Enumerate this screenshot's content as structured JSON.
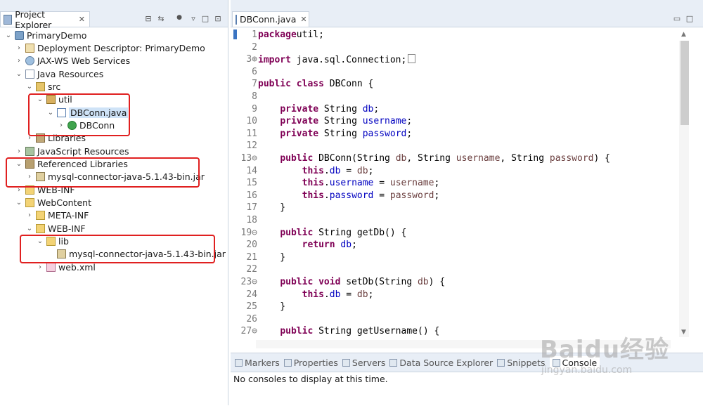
{
  "explorer": {
    "tab_label": "Project Explorer",
    "tab_close": "✕",
    "toolbar": [
      "⊟",
      "⇆",
      "▿",
      "□",
      "⊡"
    ],
    "tree": [
      {
        "indent": 0,
        "twisty": "v",
        "icon": "i-proj",
        "label": "PrimaryDemo",
        "name": "tree-item-primarydemo"
      },
      {
        "indent": 1,
        "twisty": ">",
        "icon": "i-dd",
        "label": "Deployment Descriptor: PrimaryDemo",
        "name": "tree-item-deployment-descriptor"
      },
      {
        "indent": 1,
        "twisty": ">",
        "icon": "i-ws",
        "label": "JAX-WS Web Services",
        "name": "tree-item-jax-ws"
      },
      {
        "indent": 1,
        "twisty": "v",
        "icon": "i-jr",
        "label": "Java Resources",
        "name": "tree-item-java-resources"
      },
      {
        "indent": 2,
        "twisty": "v",
        "icon": "i-src",
        "label": "src",
        "name": "tree-item-src"
      },
      {
        "indent": 3,
        "twisty": "v",
        "icon": "i-pkg",
        "label": "util",
        "name": "tree-item-util"
      },
      {
        "indent": 4,
        "twisty": "v",
        "icon": "i-java",
        "label": "DBConn.java",
        "name": "tree-item-dbconn-java",
        "selected": true
      },
      {
        "indent": 5,
        "twisty": ">",
        "icon": "i-cls",
        "label": "DBConn",
        "name": "tree-item-dbconn-class"
      },
      {
        "indent": 2,
        "twisty": ">",
        "icon": "i-lib",
        "label": "Libraries",
        "name": "tree-item-libraries"
      },
      {
        "indent": 1,
        "twisty": ">",
        "icon": "i-js",
        "label": "JavaScript Resources",
        "name": "tree-item-javascript-resources"
      },
      {
        "indent": 1,
        "twisty": "v",
        "icon": "i-ref",
        "label": "Referenced Libraries",
        "name": "tree-item-referenced-libraries"
      },
      {
        "indent": 2,
        "twisty": ">",
        "icon": "i-jar",
        "label": "mysql-connector-java-5.1.43-bin.jar",
        "name": "tree-item-ref-jar"
      },
      {
        "indent": 1,
        "twisty": ">",
        "icon": "i-fold",
        "label": "WEB-INF",
        "name": "tree-item-web-inf-root"
      },
      {
        "indent": 1,
        "twisty": "v",
        "icon": "i-fold",
        "label": "WebContent",
        "name": "tree-item-webcontent"
      },
      {
        "indent": 2,
        "twisty": ">",
        "icon": "i-fold",
        "label": "META-INF",
        "name": "tree-item-meta-inf"
      },
      {
        "indent": 2,
        "twisty": "v",
        "icon": "i-fold",
        "label": "WEB-INF",
        "name": "tree-item-web-inf"
      },
      {
        "indent": 3,
        "twisty": "v",
        "icon": "i-fold",
        "label": "lib",
        "name": "tree-item-lib"
      },
      {
        "indent": 4,
        "twisty": "",
        "icon": "i-jar",
        "label": "mysql-connector-java-5.1.43-bin.jar",
        "name": "tree-item-lib-jar"
      },
      {
        "indent": 3,
        "twisty": ">",
        "icon": "i-xml",
        "label": "web.xml",
        "name": "tree-item-web-xml"
      }
    ]
  },
  "editor": {
    "tab_label": "DBConn.java",
    "tab_close": "✕",
    "lines": [
      {
        "n": "1",
        "code": [
          [
            "kw",
            "package"
          ],
          [
            "",
            "util;"
          ]
        ]
      },
      {
        "n": "2",
        "code": []
      },
      {
        "n": "3⊕",
        "code": [
          [
            "kw",
            "import"
          ],
          [
            "",
            " java.sql.Connection;"
          ],
          [
            "box",
            "□"
          ]
        ]
      },
      {
        "n": "6",
        "code": []
      },
      {
        "n": "7",
        "code": [
          [
            "kw",
            "public class"
          ],
          [
            "",
            " DBConn {"
          ]
        ]
      },
      {
        "n": "8",
        "code": []
      },
      {
        "n": "9",
        "code": [
          [
            "",
            "    "
          ],
          [
            "kw",
            "private"
          ],
          [
            "",
            " String "
          ],
          [
            "fld",
            "db"
          ],
          [
            "",
            ";"
          ]
        ]
      },
      {
        "n": "10",
        "code": [
          [
            "",
            "    "
          ],
          [
            "kw",
            "private"
          ],
          [
            "",
            " String "
          ],
          [
            "fld",
            "username"
          ],
          [
            "",
            ";"
          ]
        ]
      },
      {
        "n": "11",
        "code": [
          [
            "",
            "    "
          ],
          [
            "kw",
            "private"
          ],
          [
            "",
            " String "
          ],
          [
            "fld",
            "password"
          ],
          [
            "",
            ";"
          ]
        ]
      },
      {
        "n": "12",
        "code": []
      },
      {
        "n": "13⊖",
        "code": [
          [
            "",
            "    "
          ],
          [
            "kw",
            "public"
          ],
          [
            "",
            " DBConn(String "
          ],
          [
            "prm",
            "db"
          ],
          [
            "",
            ", String "
          ],
          [
            "prm",
            "username"
          ],
          [
            "",
            ", String "
          ],
          [
            "prm",
            "password"
          ],
          [
            "",
            ") {"
          ]
        ]
      },
      {
        "n": "14",
        "code": [
          [
            "",
            "        "
          ],
          [
            "kw",
            "this"
          ],
          [
            "",
            "."
          ],
          [
            "fld",
            "db"
          ],
          [
            "",
            " = "
          ],
          [
            "prm",
            "db"
          ],
          [
            "",
            ";"
          ]
        ]
      },
      {
        "n": "15",
        "code": [
          [
            "",
            "        "
          ],
          [
            "kw",
            "this"
          ],
          [
            "",
            "."
          ],
          [
            "fld",
            "username"
          ],
          [
            "",
            " = "
          ],
          [
            "prm",
            "username"
          ],
          [
            "",
            ";"
          ]
        ]
      },
      {
        "n": "16",
        "code": [
          [
            "",
            "        "
          ],
          [
            "kw",
            "this"
          ],
          [
            "",
            "."
          ],
          [
            "fld",
            "password"
          ],
          [
            "",
            " = "
          ],
          [
            "prm",
            "password"
          ],
          [
            "",
            ";"
          ]
        ]
      },
      {
        "n": "17",
        "code": [
          [
            "",
            "    }"
          ]
        ]
      },
      {
        "n": "18",
        "code": []
      },
      {
        "n": "19⊖",
        "code": [
          [
            "",
            "    "
          ],
          [
            "kw",
            "public"
          ],
          [
            "",
            " String getDb() {"
          ]
        ]
      },
      {
        "n": "20",
        "code": [
          [
            "",
            "        "
          ],
          [
            "kw",
            "return"
          ],
          [
            "",
            " "
          ],
          [
            "fld",
            "db"
          ],
          [
            "",
            ";"
          ]
        ]
      },
      {
        "n": "21",
        "code": [
          [
            "",
            "    }"
          ]
        ]
      },
      {
        "n": "22",
        "code": []
      },
      {
        "n": "23⊖",
        "code": [
          [
            "",
            "    "
          ],
          [
            "kw",
            "public void"
          ],
          [
            "",
            " setDb(String "
          ],
          [
            "prm",
            "db"
          ],
          [
            "",
            ") {"
          ]
        ]
      },
      {
        "n": "24",
        "code": [
          [
            "",
            "        "
          ],
          [
            "kw",
            "this"
          ],
          [
            "",
            "."
          ],
          [
            "fld",
            "db"
          ],
          [
            "",
            " = "
          ],
          [
            "prm",
            "db"
          ],
          [
            "",
            ";"
          ]
        ]
      },
      {
        "n": "25",
        "code": [
          [
            "",
            "    }"
          ]
        ]
      },
      {
        "n": "26",
        "code": []
      },
      {
        "n": "27⊖",
        "code": [
          [
            "",
            "    "
          ],
          [
            "kw",
            "public"
          ],
          [
            "",
            " String getUsername() {"
          ]
        ]
      }
    ]
  },
  "bottom": {
    "tabs": [
      {
        "label": "Markers",
        "name": "tab-markers"
      },
      {
        "label": "Properties",
        "name": "tab-properties"
      },
      {
        "label": "Servers",
        "name": "tab-servers"
      },
      {
        "label": "Data Source Explorer",
        "name": "tab-data-source-explorer"
      },
      {
        "label": "Snippets",
        "name": "tab-snippets"
      },
      {
        "label": "Console",
        "name": "tab-console",
        "active": true
      }
    ],
    "console_message": "No consoles to display at this time."
  },
  "watermark": {
    "brand": "Baidu经验",
    "url": "jingyan.baidu.com"
  },
  "colors": {
    "highlight_box": "#e02020",
    "keyword": "#7f0055",
    "field": "#0000c0",
    "panel_bg": "#e8eef6"
  }
}
